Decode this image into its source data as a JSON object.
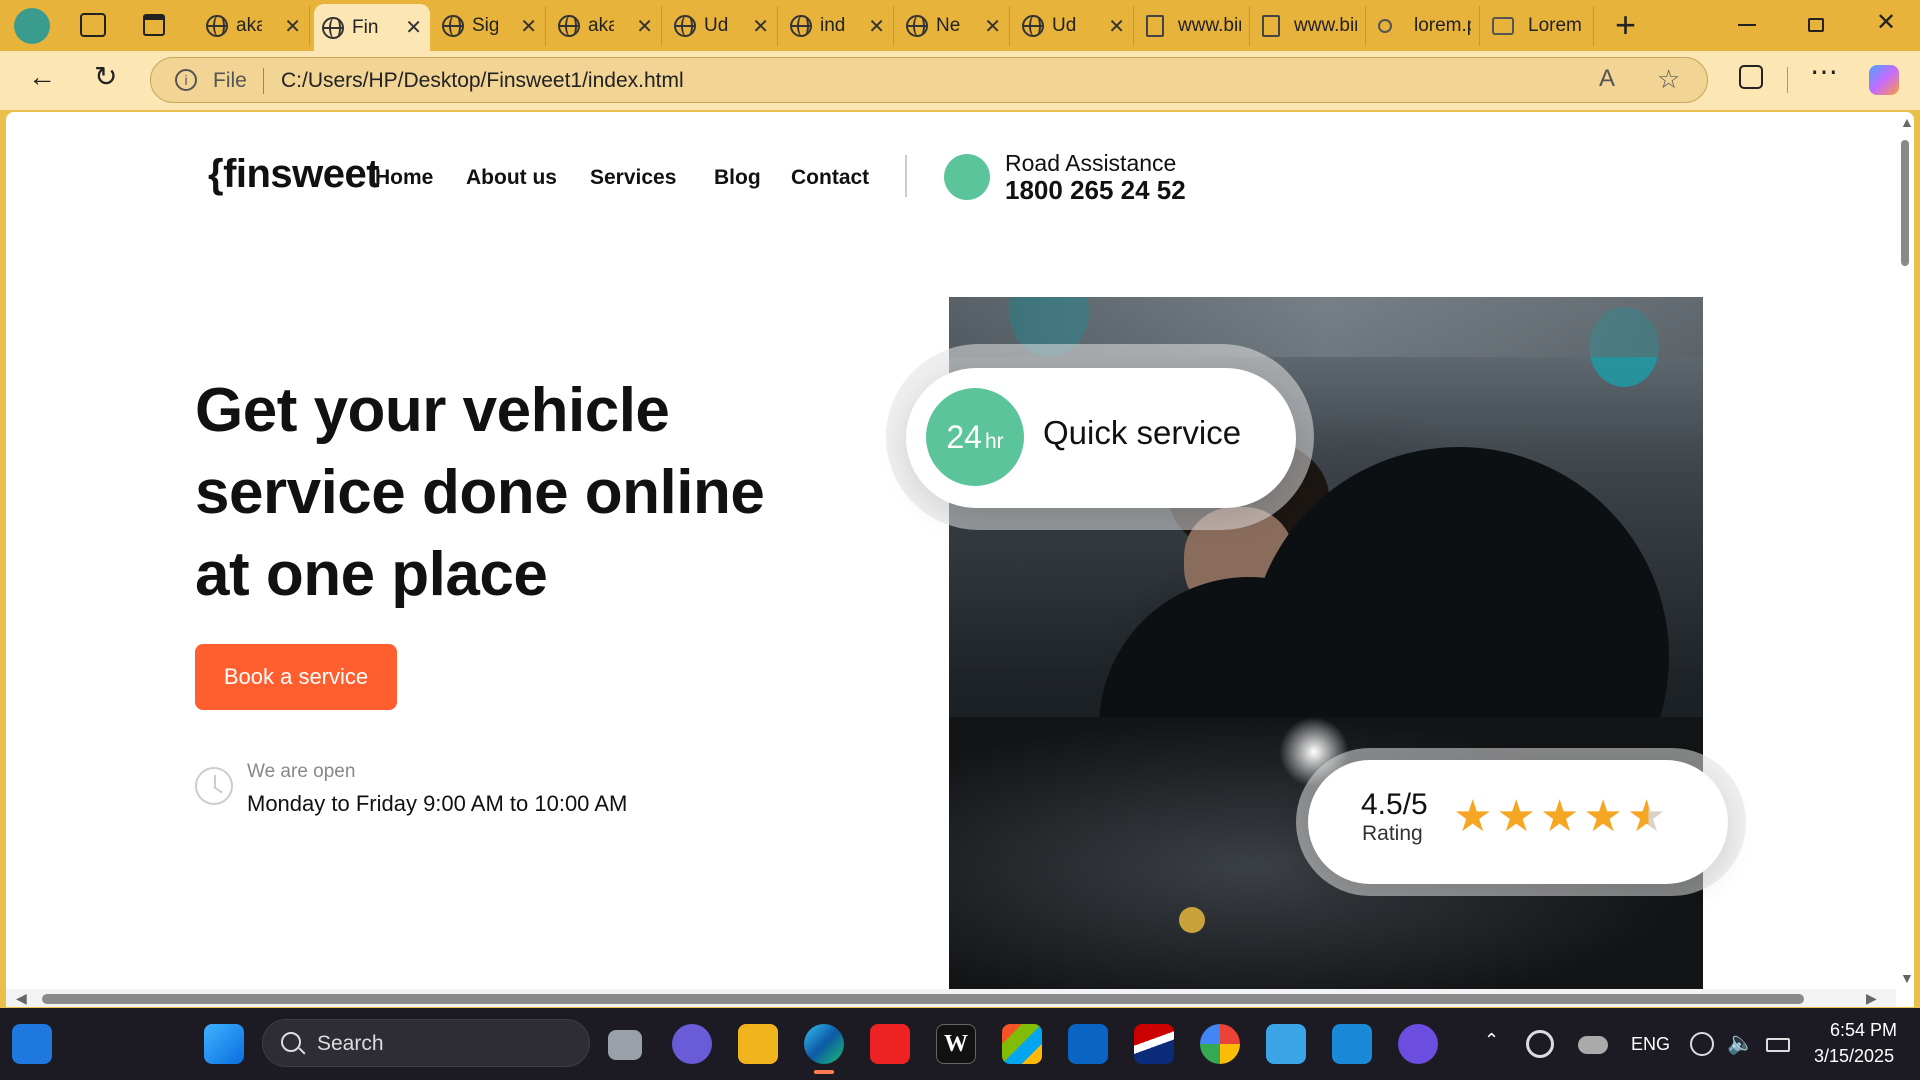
{
  "browser": {
    "tabs": [
      {
        "label": "aka",
        "icon": "globe-icon",
        "active": false
      },
      {
        "label": "Fin",
        "icon": "globe-icon",
        "active": true
      },
      {
        "label": "Sig",
        "icon": "globe-icon",
        "active": false
      },
      {
        "label": "aka",
        "icon": "globe-icon",
        "active": false
      },
      {
        "label": "Ud",
        "icon": "globe-icon",
        "active": false
      },
      {
        "label": "ind",
        "icon": "globe-icon",
        "active": false
      },
      {
        "label": "Ne",
        "icon": "globe-icon",
        "active": false
      },
      {
        "label": "Ud",
        "icon": "globe-icon",
        "active": false
      },
      {
        "label": "www.bir",
        "icon": "document-icon",
        "active": false
      },
      {
        "label": "www.bir",
        "icon": "document-icon",
        "active": false
      },
      {
        "label": "lorem.p",
        "icon": "search-icon",
        "active": false
      },
      {
        "label": "Lorem P",
        "icon": "image-icon",
        "active": false
      }
    ],
    "address": {
      "scheme_label": "File",
      "url": "C:/Users/HP/Desktop/Finsweet1/index.html"
    },
    "tab_close_glyph": "✕",
    "new_tab_glyph": "+"
  },
  "site": {
    "logo": "{finsweet",
    "nav": [
      "Home",
      "About us",
      "Services",
      "Blog",
      "Contact"
    ],
    "assistance": {
      "label": "Road Assistance",
      "phone": "1800 265 24 52"
    }
  },
  "hero": {
    "title": "Get your vehicle service done online at one place",
    "cta": "Book a service",
    "hours_label": "We are open",
    "hours": "Monday to Friday 9:00 AM to 10:00 AM"
  },
  "quick_service": {
    "number": "24",
    "unit": "hr",
    "text": "Quick service"
  },
  "rating": {
    "value": "4.5/5",
    "label": "Rating",
    "stars": 4.5,
    "max_stars": 5
  },
  "colors": {
    "accent_green": "#5cc49a",
    "cta_orange": "#ff5f2e",
    "star": "#f5a623"
  },
  "taskbar": {
    "search_label": "Search",
    "language": "ENG",
    "time": "6:54 PM",
    "date": "3/15/2025"
  }
}
